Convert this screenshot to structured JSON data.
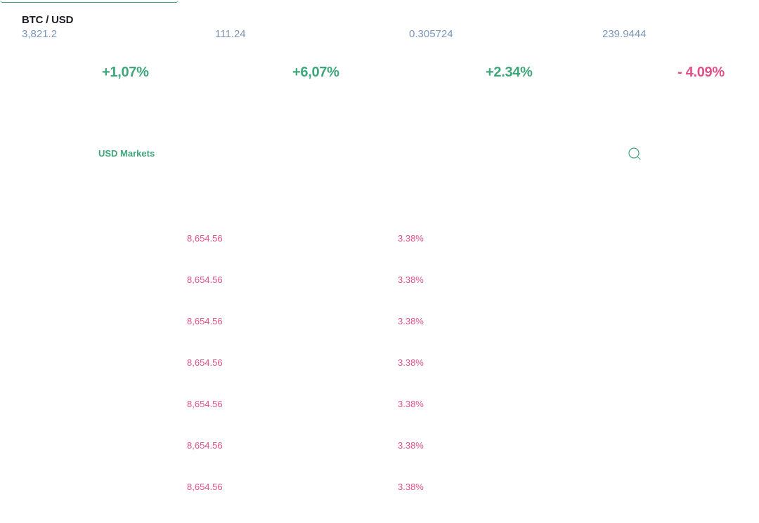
{
  "ticker": {
    "pair": "BTC / USD",
    "prices": [
      "3,821.2",
      "111.24",
      "0.305724",
      "239.9444"
    ],
    "changes": [
      "+1,07%",
      "+6,07%",
      "+2.34%",
      "- 4.09%"
    ]
  },
  "markets": {
    "label": "USD Markets",
    "search_icon": "search-icon"
  },
  "table": {
    "rows": [
      {
        "price": "8,654.56",
        "change": "3.38%"
      },
      {
        "price": "8,654.56",
        "change": "3.38%"
      },
      {
        "price": "8,654.56",
        "change": "3.38%"
      },
      {
        "price": "8,654.56",
        "change": "3.38%"
      },
      {
        "price": "8,654.56",
        "change": "3.38%"
      },
      {
        "price": "8,654.56",
        "change": "3.38%"
      },
      {
        "price": "8,654.56",
        "change": "3.38%"
      }
    ]
  },
  "colors": {
    "up": "#3fa67a",
    "down": "#e0508a",
    "price": "#7b95b4",
    "title": "#1c1c24"
  }
}
